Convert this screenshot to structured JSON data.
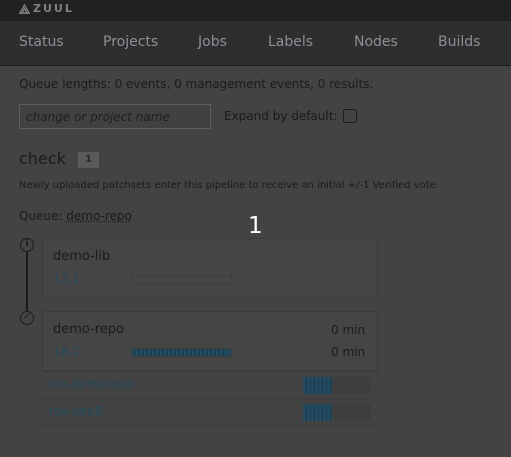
{
  "brand": {
    "name": "ZUUL"
  },
  "nav": [
    "Status",
    "Projects",
    "Jobs",
    "Labels",
    "Nodes",
    "Builds"
  ],
  "queue_lengths": "Queue lengths: 0 events, 0 management events, 0 results.",
  "filter": {
    "placeholder": "change or project name",
    "value": ""
  },
  "expand": {
    "label": "Expand by default:",
    "checked": false
  },
  "pipeline": {
    "name": "check",
    "count": "1",
    "description": "Newly uploaded patchsets enter this pipeline to receive an initial +/-1 Verified vote.",
    "queue_prefix": "Queue:",
    "queue_name": "demo-repo"
  },
  "page_indicator": "1",
  "changes": [
    {
      "project": "demo-lib",
      "change": "17,1",
      "progress": 0,
      "status": "info",
      "time": "",
      "time2": ""
    },
    {
      "project": "demo-repo",
      "change": "18,2",
      "progress": 1.0,
      "status": "check",
      "time": "0 min",
      "time2": "0 min",
      "jobs": [
        {
          "name": "tox-demorepo",
          "progress": 0.42
        },
        {
          "name": "tox-pep8",
          "progress": 0.42
        }
      ]
    }
  ],
  "colors": {
    "topbar": "#202122",
    "navbar": "#2d2e30",
    "link": "#22485d",
    "progress": "#234b60"
  }
}
